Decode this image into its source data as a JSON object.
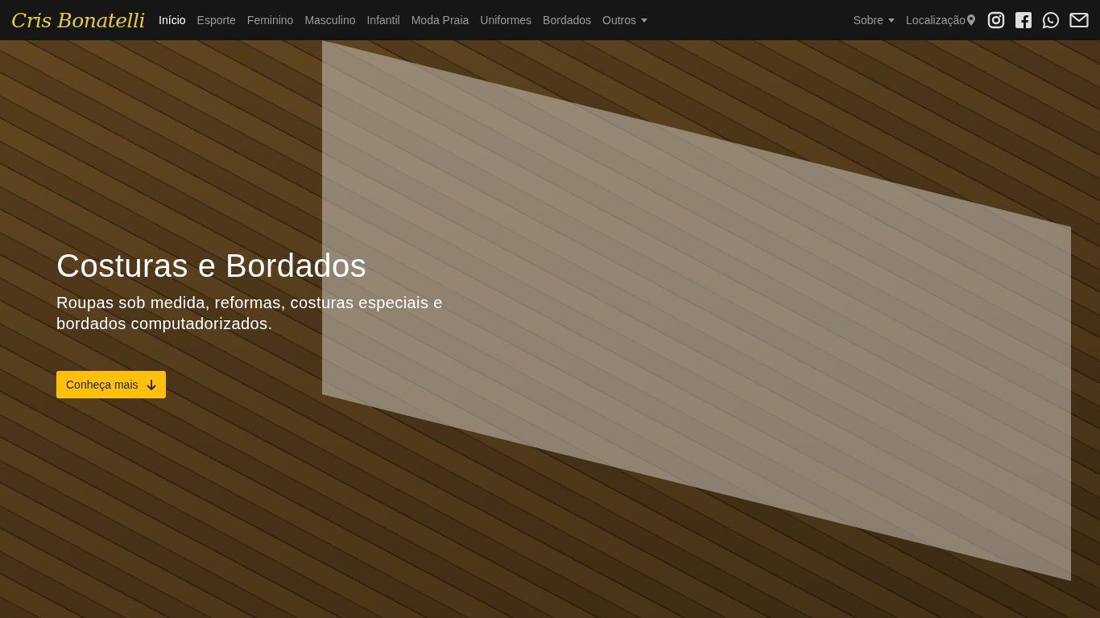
{
  "navbar": {
    "brand": "Cris Bonatelli",
    "items": [
      {
        "label": "Início",
        "kind": "link",
        "selected": true
      },
      {
        "label": "Esporte",
        "kind": "link",
        "selected": false
      },
      {
        "label": "Feminino",
        "kind": "link",
        "selected": false
      },
      {
        "label": "Masculino",
        "kind": "link",
        "selected": false
      },
      {
        "label": "Infantil",
        "kind": "link",
        "selected": false
      },
      {
        "label": "Moda Praia",
        "kind": "link",
        "selected": false
      },
      {
        "label": "Uniformes",
        "kind": "link",
        "selected": false
      },
      {
        "label": "Bordados",
        "kind": "link",
        "selected": false
      },
      {
        "label": "Outros",
        "kind": "dropdown",
        "selected": false
      }
    ],
    "right_items": [
      {
        "label": "Sobre",
        "kind": "dropdown"
      },
      {
        "label": "Localização",
        "kind": "location"
      }
    ]
  },
  "hero": {
    "title": "Costuras e Bordados",
    "subtitle": "Roupas sob medida, reformas, costuras especiais e bordados computadorizados.",
    "button": "Conheça mais"
  }
}
